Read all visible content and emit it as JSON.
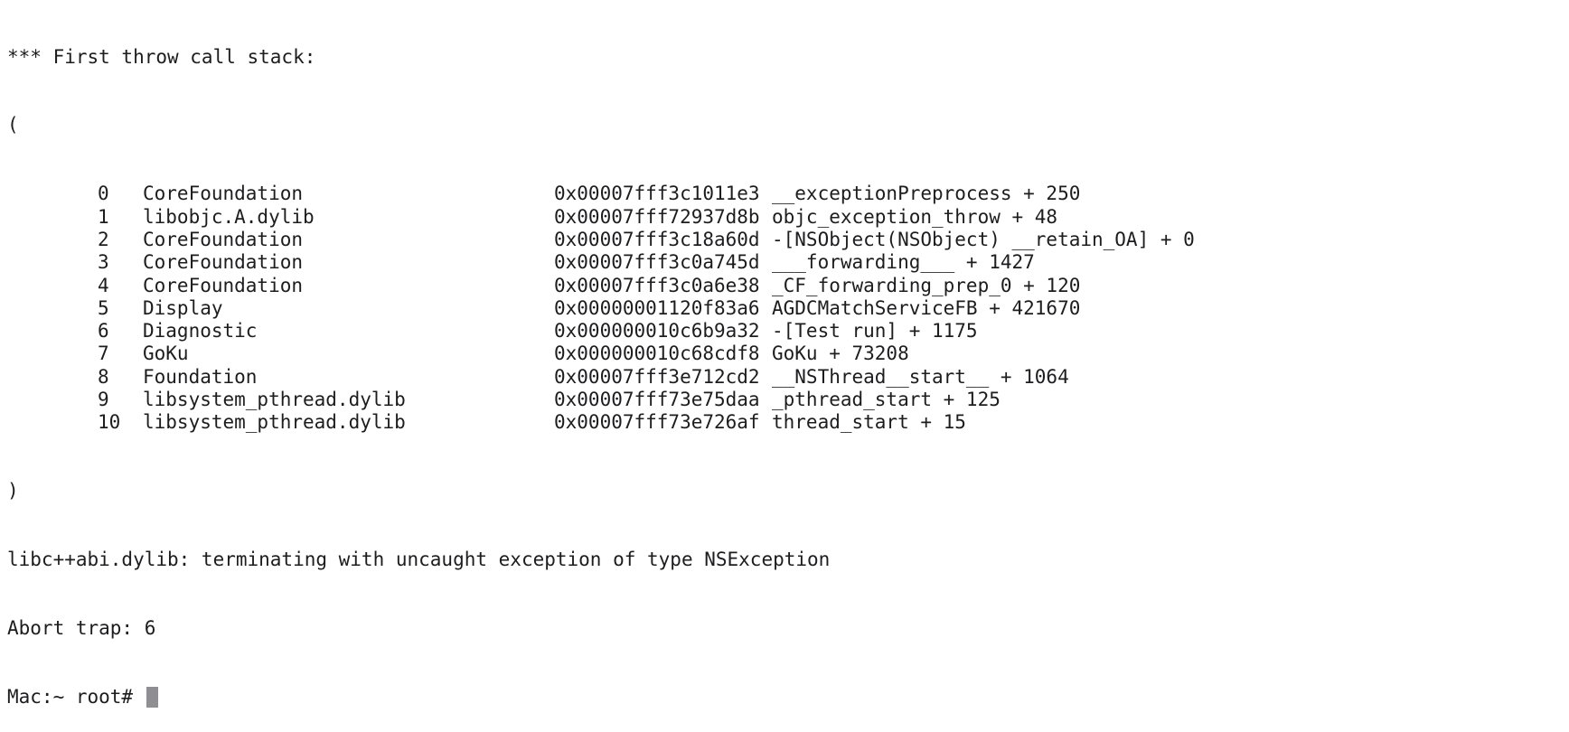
{
  "terminal": {
    "header": "*** First throw call stack:",
    "open_paren": "(",
    "frames": [
      {
        "index": "0",
        "library": "CoreFoundation",
        "address": "0x00007fff3c1011e3",
        "symbol": "__exceptionPreprocess + 250"
      },
      {
        "index": "1",
        "library": "libobjc.A.dylib",
        "address": "0x00007fff72937d8b",
        "symbol": "objc_exception_throw + 48"
      },
      {
        "index": "2",
        "library": "CoreFoundation",
        "address": "0x00007fff3c18a60d",
        "symbol": "-[NSObject(NSObject) __retain_OA] + 0"
      },
      {
        "index": "3",
        "library": "CoreFoundation",
        "address": "0x00007fff3c0a745d",
        "symbol": "___forwarding___ + 1427"
      },
      {
        "index": "4",
        "library": "CoreFoundation",
        "address": "0x00007fff3c0a6e38",
        "symbol": "_CF_forwarding_prep_0 + 120"
      },
      {
        "index": "5",
        "library": "Display",
        "address": "0x00000001120f83a6",
        "symbol": "AGDCMatchServiceFB + 421670"
      },
      {
        "index": "6",
        "library": "Diagnostic",
        "address": "0x000000010c6b9a32",
        "symbol": "-[Test run] + 1175"
      },
      {
        "index": "7",
        "library": "GoKu",
        "address": "0x000000010c68cdf8",
        "symbol": "GoKu + 73208"
      },
      {
        "index": "8",
        "library": "Foundation",
        "address": "0x00007fff3e712cd2",
        "symbol": "__NSThread__start__ + 1064"
      },
      {
        "index": "9",
        "library": "libsystem_pthread.dylib",
        "address": "0x00007fff73e75daa",
        "symbol": "_pthread_start + 125"
      },
      {
        "index": "10",
        "library": "libsystem_pthread.dylib",
        "address": "0x00007fff73e726af",
        "symbol": "thread_start + 15"
      }
    ],
    "close_paren": ")",
    "termination_message": "libc++abi.dylib: terminating with uncaught exception of type NSException",
    "abort_message": "Abort trap: 6",
    "prompt": "Mac:~ root# "
  },
  "colors": {
    "background": "#ffffff",
    "text": "#1d1d1f",
    "cursor": "#8e8e93"
  }
}
